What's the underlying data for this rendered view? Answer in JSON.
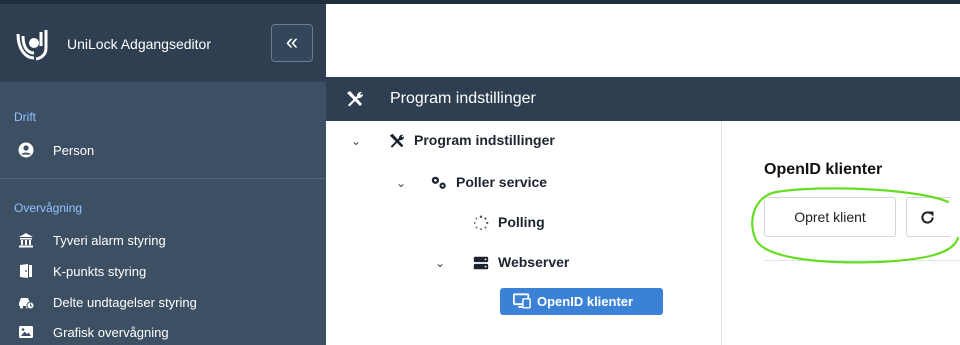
{
  "app": {
    "title": "UniLock Adgangseditor",
    "collapse_glyph": "«"
  },
  "sidebar": {
    "sections": [
      {
        "label": "Drift",
        "items": [
          {
            "label": "Person",
            "icon": "user-circle-icon"
          }
        ]
      },
      {
        "label": "Overvågning",
        "items": [
          {
            "label": "Tyveri alarm styring",
            "icon": "building-alarm-icon"
          },
          {
            "label": "K-punkts styring",
            "icon": "door-icon"
          },
          {
            "label": "Delte undtagelser styring",
            "icon": "car-clock-icon"
          },
          {
            "label": "Grafisk overvågning",
            "icon": "image-icon"
          }
        ]
      }
    ]
  },
  "header": {
    "title": "Program indstillinger",
    "icon": "tools-icon"
  },
  "tree": {
    "nodes": [
      {
        "label": "Program indstillinger",
        "icon": "tools-icon",
        "expanded": true
      },
      {
        "label": "Poller service",
        "icon": "gears-icon",
        "expanded": true
      },
      {
        "label": "Polling",
        "icon": "spinner-icon"
      },
      {
        "label": "Webserver",
        "icon": "server-icon",
        "expanded": true
      },
      {
        "label": "OpenID klienter",
        "icon": "desktop-icon",
        "selected": true
      }
    ]
  },
  "content": {
    "title": "OpenID klienter",
    "create_button": "Opret klient",
    "refresh_icon": "refresh-icon"
  },
  "colors": {
    "sidebar_bg": "#3d4f63",
    "sidebar_header_bg": "#2f3f51",
    "section_label": "#8fc2ff",
    "page_header_bg": "#2f3f51",
    "selected_node_bg": "#3b82d6",
    "annotation": "#66dd22"
  }
}
